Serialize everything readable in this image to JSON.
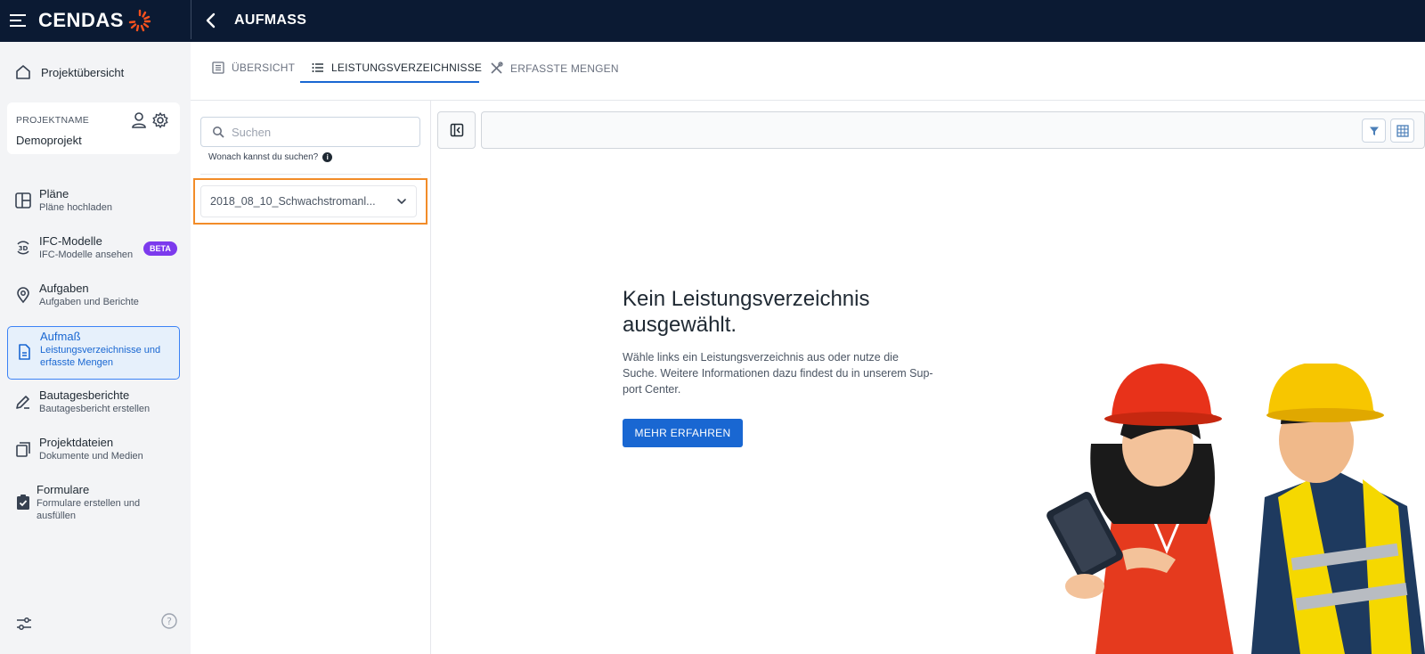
{
  "topbar": {
    "logo_text": "CENDAS",
    "title": "AUFMASS",
    "icons": [
      "hamburger-icon",
      "chevron-left-icon"
    ]
  },
  "sidebar": {
    "overview": "Projektübersicht",
    "project": {
      "label": "PROJEKTNAME",
      "name": "Demoprojekt"
    },
    "items": [
      {
        "title": "Pläne",
        "sub": "Pläne hochladen",
        "icon": "plans-icon"
      },
      {
        "title": "IFC-Modelle",
        "sub": "IFC-Modelle ansehen",
        "icon": "3d-icon",
        "badge": "BETA"
      },
      {
        "title": "Aufgaben",
        "sub": "Aufgaben und Berichte",
        "icon": "location-pin-icon"
      },
      {
        "title": "Aufmaß",
        "sub": "Leistungsverzeichnisse und erfasste Mengen",
        "icon": "document-icon",
        "active": true
      },
      {
        "title": "Bautagesberichte",
        "sub": "Bautagesbericht erstellen",
        "icon": "pencil-icon"
      },
      {
        "title": "Projektdateien",
        "sub": "Dokumente und Medien",
        "icon": "files-icon"
      },
      {
        "title": "Formulare",
        "sub": "Formulare erstellen und ausfüllen",
        "icon": "clipboard-check-icon"
      }
    ],
    "footer_icons": [
      "sliders-icon",
      "help-icon"
    ]
  },
  "tabs": [
    {
      "label": "ÜBERSICHT",
      "icon": "list-doc-icon"
    },
    {
      "label": "LEISTUNGSVERZEICHNISSE",
      "icon": "list-icon",
      "active": true
    },
    {
      "label": "ERFASSTE MENGEN",
      "icon": "tools-icon"
    }
  ],
  "leftpane": {
    "search_placeholder": "Suchen",
    "search_hint": "Wonach kannst du suchen?",
    "items": [
      "2018_08_10_Schwachstromanl..."
    ]
  },
  "empty_state": {
    "title": "Kein Leistungsverzeichnis ausgewählt.",
    "text": "Wähle links ein Leistungsverzeichnis aus oder nutze die Suche. Weitere Informationen dazu findest du in unserem Sup-port Center.",
    "button": "MEHR ERFAHREN"
  },
  "colors": {
    "topbar": "#0b1a33",
    "accent": "#1967d2",
    "beta": "#7c3aed",
    "highlight": "#f28c28"
  }
}
